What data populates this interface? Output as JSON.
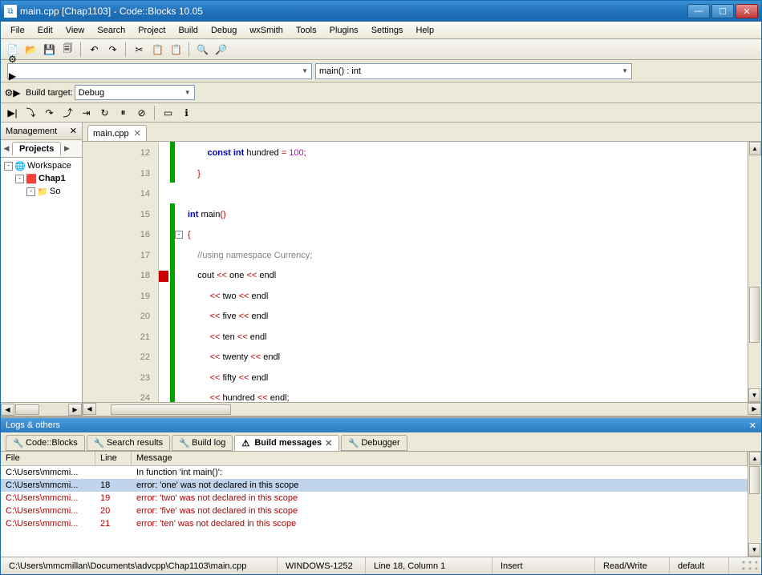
{
  "titlebar": {
    "text": "main.cpp [Chap1103] - Code::Blocks 10.05",
    "icon": "⧉"
  },
  "menubar": [
    "File",
    "Edit",
    "View",
    "Search",
    "Project",
    "Build",
    "Debug",
    "wxSmith",
    "Tools",
    "Plugins",
    "Settings",
    "Help"
  ],
  "toolbar1_icons": [
    "📄",
    "📂",
    "💾",
    "🗐",
    "",
    "↶",
    "↷",
    "",
    "✂",
    "📋",
    "📋",
    "",
    "🔍",
    "🔎"
  ],
  "nav_combo_left": "",
  "nav_combo_right": "main() : int",
  "build_toolbar_icons": [
    "⚙",
    "▶",
    "⚙▶",
    "⟳",
    "■"
  ],
  "build_target_label": "Build target:",
  "build_target_value": "Debug",
  "debug_toolbar_icons": [
    "▶|",
    "⤵",
    "↷",
    "⤴",
    "⇥",
    "↻",
    "⏸",
    "⊘",
    "",
    "▭",
    "ℹ"
  ],
  "sidebar": {
    "title": "Management",
    "tab": "Projects",
    "tree": [
      {
        "indent": 0,
        "exp": "-",
        "icon": "🌐",
        "label": "Workspace",
        "bold": false
      },
      {
        "indent": 1,
        "exp": "-",
        "icon": "🟥",
        "label": "Chap1",
        "bold": true
      },
      {
        "indent": 2,
        "exp": "-",
        "icon": "📁",
        "label": "So",
        "bold": false
      }
    ]
  },
  "editor": {
    "tab_name": "main.cpp",
    "lines": [
      {
        "n": 12,
        "change": true,
        "fold": "",
        "html": "        <span class='kw'>const</span> <span class='kw'>int</span> <span class='txt'>hundred</span> <span class='op'>=</span> <span class='num'>100</span><span class='op'>;</span>"
      },
      {
        "n": 13,
        "change": true,
        "fold": "",
        "html": "    <span class='op'>}</span>"
      },
      {
        "n": 14,
        "change": false,
        "fold": "",
        "html": ""
      },
      {
        "n": 15,
        "change": true,
        "fold": "",
        "html": "<span class='kw'>int</span> <span class='txt'>main</span><span class='op'>()</span>"
      },
      {
        "n": 16,
        "change": true,
        "fold": "-",
        "html": "<span class='op'>{</span>"
      },
      {
        "n": 17,
        "change": true,
        "fold": "",
        "html": "    <span class='cmt'>//using namespace Currency;</span>"
      },
      {
        "n": 18,
        "change": true,
        "fold": "",
        "marker": true,
        "html": "    <span class='txt'>cout</span> <span class='op'>&lt;&lt;</span> <span class='txt'>one</span> <span class='op'>&lt;&lt;</span> <span class='txt'>endl</span>"
      },
      {
        "n": 19,
        "change": true,
        "fold": "",
        "html": "         <span class='op'>&lt;&lt;</span> <span class='txt'>two</span> <span class='op'>&lt;&lt;</span> <span class='txt'>endl</span>"
      },
      {
        "n": 20,
        "change": true,
        "fold": "",
        "html": "         <span class='op'>&lt;&lt;</span> <span class='txt'>five</span> <span class='op'>&lt;&lt;</span> <span class='txt'>endl</span>"
      },
      {
        "n": 21,
        "change": true,
        "fold": "",
        "html": "         <span class='op'>&lt;&lt;</span> <span class='txt'>ten</span> <span class='op'>&lt;&lt;</span> <span class='txt'>endl</span>"
      },
      {
        "n": 22,
        "change": true,
        "fold": "",
        "html": "         <span class='op'>&lt;&lt;</span> <span class='txt'>twenty</span> <span class='op'>&lt;&lt;</span> <span class='txt'>endl</span>"
      },
      {
        "n": 23,
        "change": true,
        "fold": "",
        "html": "         <span class='op'>&lt;&lt;</span> <span class='txt'>fifty</span> <span class='op'>&lt;&lt;</span> <span class='txt'>endl</span>"
      },
      {
        "n": 24,
        "change": true,
        "fold": "",
        "html": "         <span class='op'>&lt;&lt;</span> <span class='txt'>hundred</span> <span class='op'>&lt;&lt;</span> <span class='txt'>endl</span><span class='op'>;</span>"
      }
    ]
  },
  "log": {
    "title": "Logs & others",
    "tabs": [
      {
        "label": "Code::Blocks",
        "active": false,
        "close": false
      },
      {
        "label": "Search results",
        "active": false,
        "close": false
      },
      {
        "label": "Build log",
        "active": false,
        "close": false
      },
      {
        "label": "Build messages",
        "active": true,
        "close": true
      },
      {
        "label": "Debugger",
        "active": false,
        "close": false
      }
    ],
    "headers": [
      "File",
      "Line",
      "Message"
    ],
    "rows": [
      {
        "file": "C:\\Users\\mmcmi...",
        "line": "",
        "msg": "In function 'int main()':",
        "err": false,
        "sel": false
      },
      {
        "file": "C:\\Users\\mmcmi...",
        "line": "18",
        "msg": "error: 'one' was not declared in this scope",
        "err": false,
        "sel": true
      },
      {
        "file": "C:\\Users\\mmcmi...",
        "line": "19",
        "msg": "error: 'two' was not declared in this scope",
        "err": true,
        "sel": false
      },
      {
        "file": "C:\\Users\\mmcmi...",
        "line": "20",
        "msg": "error: 'five' was not declared in this scope",
        "err": true,
        "sel": false
      },
      {
        "file": "C:\\Users\\mmcmi...",
        "line": "21",
        "msg": "error: 'ten' was not declared in this scope",
        "err": true,
        "sel": false
      }
    ]
  },
  "statusbar": {
    "path": "C:\\Users\\mmcmillan\\Documents\\advcpp\\Chap1103\\main.cpp",
    "encoding": "WINDOWS-1252",
    "position": "Line 18, Column 1",
    "insert": "Insert",
    "rw": "Read/Write",
    "def": "default"
  }
}
